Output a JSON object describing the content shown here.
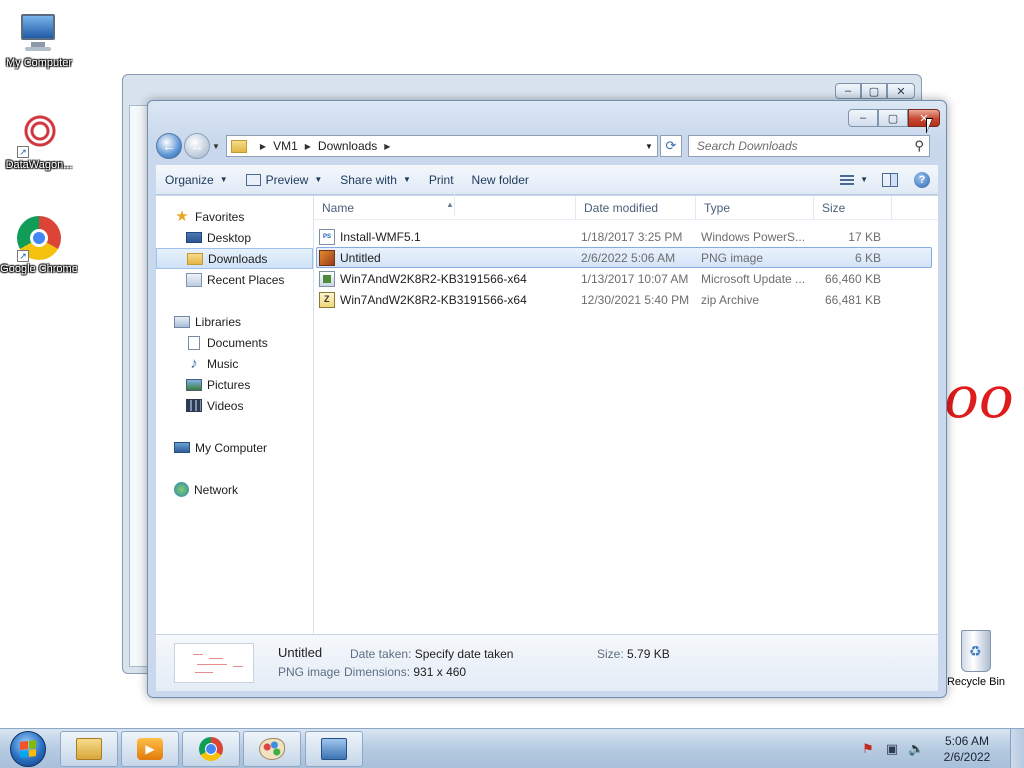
{
  "desktop": {
    "icons": [
      {
        "label": "My Computer",
        "icon": "my-computer-icon"
      },
      {
        "label": "DataWagon...",
        "icon": "datawagon-icon"
      },
      {
        "label": "Google Chrome",
        "icon": "chrome-icon"
      }
    ],
    "recycle_bin": "Recycle Bin"
  },
  "explorer": {
    "breadcrumb": [
      "VM1",
      "Downloads"
    ],
    "search_placeholder": "Search Downloads",
    "toolbar": {
      "organize": "Organize",
      "preview": "Preview",
      "share_with": "Share with",
      "print": "Print",
      "new_folder": "New folder"
    },
    "nav": {
      "favorites": "Favorites",
      "favorites_items": [
        "Desktop",
        "Downloads",
        "Recent Places"
      ],
      "libraries": "Libraries",
      "libraries_items": [
        "Documents",
        "Music",
        "Pictures",
        "Videos"
      ],
      "computer": "My Computer",
      "network": "Network"
    },
    "columns": {
      "name": "Name",
      "date": "Date modified",
      "type": "Type",
      "size": "Size"
    },
    "files": [
      {
        "name": "Install-WMF5.1",
        "date": "1/18/2017 3:25 PM",
        "type": "Windows PowerS...",
        "size": "17 KB",
        "icon": "powershell-script-icon"
      },
      {
        "name": "Untitled",
        "date": "2/6/2022 5:06 AM",
        "type": "PNG image",
        "size": "6 KB",
        "icon": "png-image-icon"
      },
      {
        "name": "Win7AndW2K8R2-KB3191566-x64",
        "date": "1/13/2017 10:07 AM",
        "type": "Microsoft Update ...",
        "size": "66,460 KB",
        "icon": "update-package-icon"
      },
      {
        "name": "Win7AndW2K8R2-KB3191566-x64",
        "date": "12/30/2021 5:40 PM",
        "type": "zip Archive",
        "size": "66,481 KB",
        "icon": "zip-archive-icon"
      }
    ],
    "selected_file": "Untitled",
    "details": {
      "name": "Untitled",
      "type": "PNG image",
      "date_taken_label": "Date taken:",
      "date_taken_value": "Specify date taken",
      "dimensions_label": "Dimensions:",
      "dimensions_value": "931 x 460",
      "size_label": "Size:",
      "size_value": "5.79 KB"
    }
  },
  "taskbar": {
    "clock_time": "5:06 AM",
    "clock_date": "2/6/2022",
    "apps": [
      "windows-explorer",
      "media-player",
      "google-chrome",
      "paint",
      "remote-desktop"
    ]
  }
}
